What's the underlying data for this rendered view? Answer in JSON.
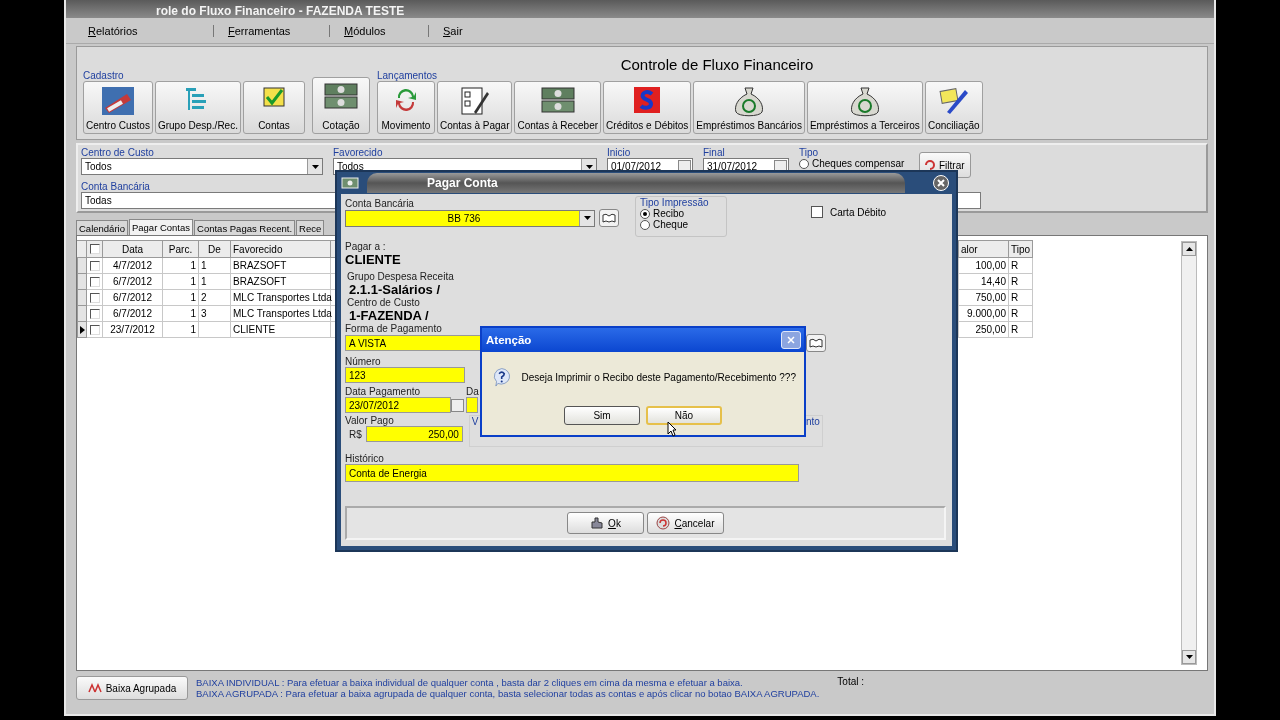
{
  "window": {
    "title": "role do Fluxo Financeiro - FAZENDA TESTE"
  },
  "menu": [
    "Relatórios",
    "Ferramentas",
    "Módulos",
    "Sair"
  ],
  "header": {
    "title": "Controle de Fluxo Financeiro"
  },
  "toolbar_groups": [
    {
      "label": "Cadastro",
      "buttons": [
        "Centro Custos",
        "Grupo Desp./Rec.",
        "Contas"
      ]
    },
    {
      "buttons": [
        "Cotação"
      ]
    },
    {
      "label": "Lançamentos",
      "buttons": [
        "Movimento",
        "Contas à Pagar",
        "Contas à Receber",
        "Créditos e Débitos",
        "Empréstimos Bancários",
        "Empréstimos a Terceiros",
        "Conciliação"
      ]
    }
  ],
  "filters": {
    "centro_de_custo": {
      "label": "Centro de Custo",
      "value": "Todos"
    },
    "favorecido": {
      "label": "Favorecido",
      "value": "Todos"
    },
    "inicio": {
      "label": "Inicio",
      "value": "01/07/2012"
    },
    "final": {
      "label": "Final",
      "value": "31/07/2012"
    },
    "tipo": {
      "label": "Tipo",
      "option": "Cheques compensar",
      "checked": false
    },
    "filter_button": "Filtrar",
    "conta_bancaria": {
      "label": "Conta Bancária",
      "value": "Todas"
    }
  },
  "tabs": [
    {
      "label": "Calendário",
      "selected": false
    },
    {
      "label": "Pagar Contas",
      "selected": true
    },
    {
      "label": "Contas Pagas Recent.",
      "selected": false
    },
    {
      "label": "Rece",
      "selected": false
    }
  ],
  "table": {
    "header_checked": false,
    "columns": [
      "Data",
      "Parc.",
      "De",
      "Favorecido",
      "alor",
      "Tipo"
    ],
    "rows": [
      {
        "current": false,
        "checked": false,
        "data": "4/7/2012",
        "parc": "1",
        "de": "1",
        "favorecido": "BRAZSOFT",
        "valor": "100,00",
        "tipo": "R"
      },
      {
        "current": false,
        "checked": false,
        "data": "6/7/2012",
        "parc": "1",
        "de": "1",
        "favorecido": "BRAZSOFT",
        "valor": "14,40",
        "tipo": "R"
      },
      {
        "current": false,
        "checked": false,
        "data": "6/7/2012",
        "parc": "1",
        "de": "2",
        "favorecido": "MLC Transportes Ltda",
        "valor": "750,00",
        "tipo": "R"
      },
      {
        "current": false,
        "checked": false,
        "data": "6/7/2012",
        "parc": "1",
        "de": "3",
        "favorecido": "MLC Transportes Ltda",
        "valor": "9.000,00",
        "tipo": "R"
      },
      {
        "current": true,
        "checked": false,
        "data": "23/7/2012",
        "parc": "1",
        "favorecido": "CLIENTE",
        "valor": "250,00",
        "tipo": "R"
      }
    ]
  },
  "footer": {
    "button": "Baixa Agrupada",
    "notes": [
      "BAIXA INDIVIDUAL : Para efetuar a baixa individual de qualquer conta , basta dar 2 cliques em cima da mesma e efetuar a baixa.",
      "BAIXA AGRUPADA : Para efetuar a baixa agrupada de qualquer conta, basta selecionar todas as contas  e após clicar no botao BAIXA AGRUPADA."
    ],
    "total_label": "Total :"
  },
  "dialog": {
    "title": "Pagar Conta",
    "conta_bancaria": {
      "label": "Conta Bancária",
      "value": "BB 736"
    },
    "tipo_impressao": {
      "label": "Tipo Impressão",
      "options": [
        {
          "label": "Recibo",
          "selected": true
        },
        {
          "label": "Cheque",
          "selected": false
        }
      ]
    },
    "carta_debito": {
      "label": "Carta Débito",
      "checked": false
    },
    "pagar_a": {
      "label": "Pagar a :",
      "value": "CLIENTE"
    },
    "grupo": {
      "label": "Grupo Despesa Receita",
      "value": "2.1.1-Salários /"
    },
    "centro_de_custo": {
      "label": "Centro de Custo",
      "value": "1-FAZENDA /"
    },
    "forma_pagamento": {
      "label": "Forma de Pagamento",
      "value": "A VISTA"
    },
    "numero": {
      "label": "Número",
      "value": "123"
    },
    "data_pagamento": {
      "label": "Data Pagamento",
      "value": "23/07/2012"
    },
    "data_2": {
      "label": "Da"
    },
    "valor_pago": {
      "label": "Valor Pago",
      "currency": "R$",
      "value": "250,00"
    },
    "group_labels": [
      "V",
      "nto"
    ],
    "historico": {
      "label": "Histórico",
      "value": "Conta de Energia"
    },
    "buttons": [
      "Ok",
      "Cancelar"
    ]
  },
  "alert": {
    "title": "Atenção",
    "message": "Deseja Imprimir o Recibo deste Pagamento/Recebimento ???",
    "buttons": [
      {
        "label": "Sim",
        "focused": false
      },
      {
        "label": "Não",
        "focused": true
      }
    ]
  }
}
